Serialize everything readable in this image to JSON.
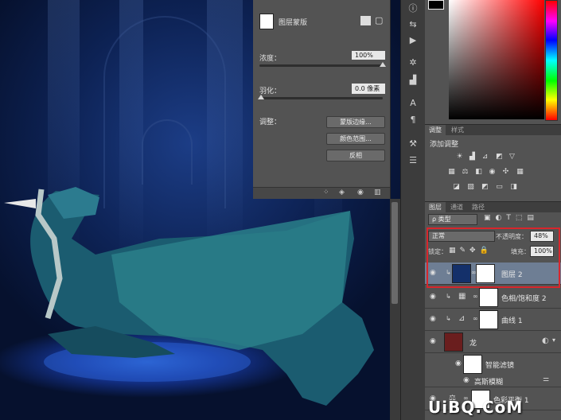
{
  "mask_panel": {
    "title": "图层蒙版",
    "density_label": "浓度：",
    "density_value": "100%",
    "density": 1.0,
    "feather_label": "羽化：",
    "feather_value": "0.0 像素",
    "adjust_label": "调整：",
    "btn_mask_edge": "蒙版边缘...",
    "btn_color_range": "颜色范围...",
    "btn_invert": "反相"
  },
  "adjustments": {
    "tab_adjust": "调整",
    "tab_styles": "样式",
    "add_label": "添加调整"
  },
  "layers_panel": {
    "tab_layers": "图层",
    "tab_channels": "通道",
    "tab_paths": "路径",
    "filter_kind": "ρ 类型",
    "blend_mode": "正常",
    "opacity_label": "不透明度：",
    "opacity_value": "48%",
    "lock_label": "锁定：",
    "fill_label": "填充：",
    "fill_value": "100%",
    "layers": [
      {
        "name": "图层 2",
        "selected": true
      },
      {
        "name": "色相/饱和度 2",
        "selected": false
      },
      {
        "name": "曲线 1",
        "selected": false
      },
      {
        "name": "龙",
        "selected": false
      },
      {
        "name": "智能滤镜",
        "selected": false
      },
      {
        "name": "高斯模糊",
        "selected": false
      },
      {
        "name": "色彩平衡 1",
        "selected": false
      }
    ]
  },
  "watermark": "UiBQ.CoM",
  "colors": {
    "highlight": "#d8262c",
    "selected_layer": "#6e7e94",
    "panel_bg": "#535353"
  }
}
